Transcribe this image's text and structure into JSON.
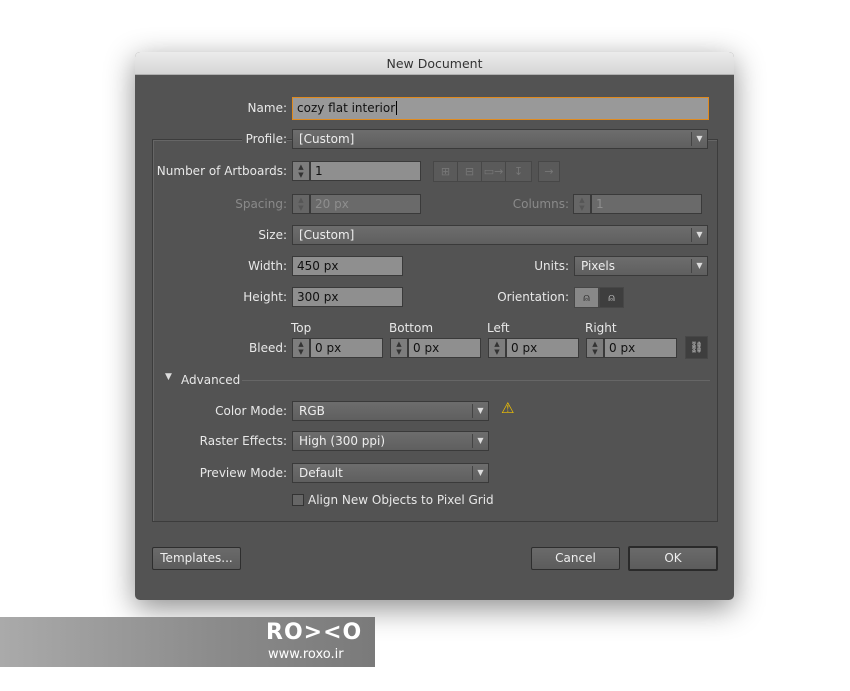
{
  "title": "New Document",
  "name": {
    "label": "Name:",
    "value": "cozy flat interior"
  },
  "profile": {
    "label": "Profile:",
    "value": "[Custom]"
  },
  "artboards": {
    "label": "Number of Artboards:",
    "value": "1"
  },
  "spacing": {
    "label": "Spacing:",
    "value": "20 px"
  },
  "columns": {
    "label": "Columns:",
    "value": "1"
  },
  "size": {
    "label": "Size:",
    "value": "[Custom]"
  },
  "width": {
    "label": "Width:",
    "value": "450 px"
  },
  "height": {
    "label": "Height:",
    "value": "300 px"
  },
  "units": {
    "label": "Units:",
    "value": "Pixels"
  },
  "orientation": {
    "label": "Orientation:",
    "selected": "portrait"
  },
  "bleed": {
    "label": "Bleed:",
    "top_label": "Top",
    "top": "0 px",
    "bottom_label": "Bottom",
    "bottom": "0 px",
    "left_label": "Left",
    "left": "0 px",
    "right_label": "Right",
    "right": "0 px"
  },
  "advanced": {
    "label": "Advanced",
    "expanded": true,
    "color_mode": {
      "label": "Color Mode:",
      "value": "RGB"
    },
    "raster": {
      "label": "Raster Effects:",
      "value": "High (300 ppi)"
    },
    "preview": {
      "label": "Preview Mode:",
      "value": "Default"
    },
    "pixel_grid": {
      "label": "Align New Objects to Pixel Grid",
      "checked": false
    }
  },
  "buttons": {
    "templates": "Templates...",
    "cancel": "Cancel",
    "ok": "OK"
  },
  "watermark": {
    "logo": "RO><O",
    "url": "www.roxo.ir"
  },
  "colors": {
    "dialog": "#535353",
    "focus": "#e08a1e",
    "warning": "#f2c200"
  }
}
